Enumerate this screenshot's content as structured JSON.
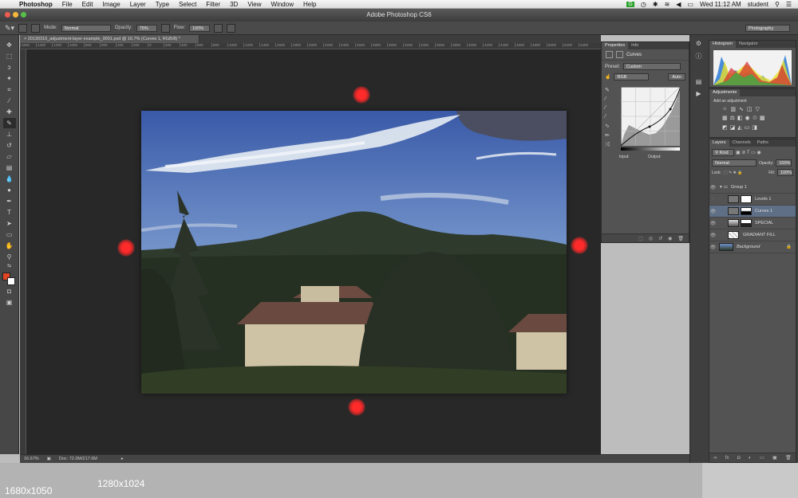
{
  "menubar": {
    "app": "Photoshop",
    "items": [
      "File",
      "Edit",
      "Image",
      "Layer",
      "Type",
      "Select",
      "Filter",
      "3D",
      "View",
      "Window",
      "Help"
    ],
    "badge": "G",
    "clock": "Wed 11:12 AM",
    "user": "student"
  },
  "window": {
    "title": "Adobe Photoshop CS6"
  },
  "options": {
    "mode_label": "Mode:",
    "mode_value": "Normal",
    "opacity_label": "Opacity:",
    "opacity_value": "75%",
    "flow_label": "Flow:",
    "flow_value": "100%",
    "workspace": "Photography"
  },
  "document": {
    "tab_title": "20130310_adjustment-layer-example_0001.psd @ 16.7% (Curves 1, RGB/8) *",
    "zoom": "16.67%",
    "doc_size": "Doc: 72.0M/217.0M"
  },
  "ruler": [
    "1600",
    "1400",
    "1200",
    "1000",
    "800",
    "600",
    "400",
    "200",
    "0",
    "200",
    "400",
    "600",
    "800",
    "1000",
    "1200",
    "1400",
    "1600",
    "1800",
    "2000",
    "2200",
    "2400",
    "2600",
    "2800",
    "3000",
    "3200",
    "3400",
    "3600",
    "3800",
    "4000",
    "4200",
    "4400",
    "4600",
    "4800",
    "5000",
    "5200",
    "5400"
  ],
  "properties": {
    "tabs": [
      "Properties",
      "Info"
    ],
    "title": "Curves",
    "preset_label": "Preset:",
    "preset_value": "Custom",
    "channel": "RGB",
    "auto_button": "Auto",
    "input_label": "Input:",
    "output_label": "Output:"
  },
  "histogram": {
    "tabs": [
      "Histogram",
      "Navigator"
    ]
  },
  "adjustments": {
    "title": "Adjustments",
    "subtitle": "Add an adjustment"
  },
  "layers": {
    "tabs": [
      "Layers",
      "Channels",
      "Paths"
    ],
    "kind": "Kind",
    "blend": "Normal",
    "opacity_label": "Opacity:",
    "opacity_value": "100%",
    "lock_label": "Lock:",
    "fill_label": "Fill:",
    "fill_value": "100%",
    "items": [
      {
        "name": "Group 1"
      },
      {
        "name": "Levels 1"
      },
      {
        "name": "Curves 1"
      },
      {
        "name": "SPECIAL"
      },
      {
        "name": "GRADIANT FILL"
      },
      {
        "name": "Background"
      }
    ]
  },
  "resolutions": {
    "outer": "1680x1050",
    "inner": "1280x1024"
  },
  "colors": {
    "foreground": "#e04526",
    "background": "#ffffff",
    "marker": "#ff2a2a",
    "selection": "#5f6f86"
  }
}
